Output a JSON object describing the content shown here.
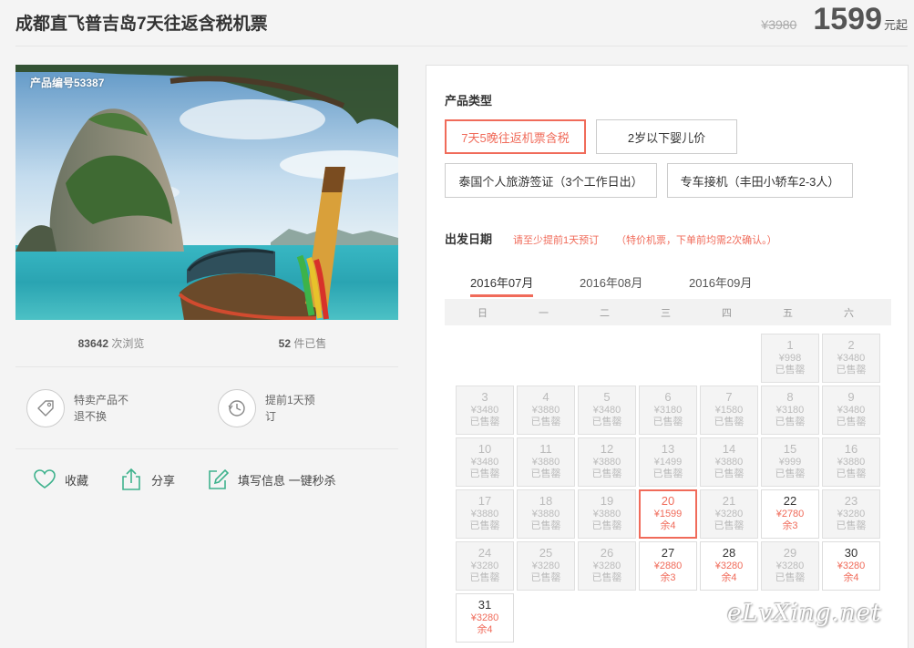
{
  "header": {
    "title": "成都直飞普吉岛7天往返含税机票",
    "old_price": "¥3980",
    "price": "1599",
    "price_suffix": "元起"
  },
  "product": {
    "code_label": "产品编号53387",
    "views_count": "83642",
    "views_label": "次浏览",
    "sold_count": "52",
    "sold_label": "件已售"
  },
  "features": [
    {
      "icon": "tag-icon",
      "text": "特卖产品不退不换"
    },
    {
      "icon": "clock-icon",
      "text": "提前1天预订"
    }
  ],
  "actions": {
    "favorite": "收藏",
    "share": "分享",
    "quick_buy": "填写信息 一键秒杀"
  },
  "booking": {
    "product_type_label": "产品类型",
    "product_types": [
      "7天5晚往返机票含税",
      "2岁以下婴儿价",
      "泰国个人旅游签证（3个工作日出）",
      "专车接机（丰田小轿车2-3人）"
    ],
    "departure_label": "出发日期",
    "note1": "请至少提前1天预订",
    "note2": "（特价机票，下单前均需2次确认。）",
    "months": [
      "2016年07月",
      "2016年08月",
      "2016年09月"
    ],
    "weekdays": [
      "日",
      "一",
      "二",
      "三",
      "四",
      "五",
      "六"
    ],
    "calendar": [
      {
        "day": "1",
        "price": "¥998",
        "status": "已售罄"
      },
      {
        "day": "2",
        "price": "¥3480",
        "status": "已售罄"
      },
      {
        "day": "3",
        "price": "¥3480",
        "status": "已售罄"
      },
      {
        "day": "4",
        "price": "¥3880",
        "status": "已售罄"
      },
      {
        "day": "5",
        "price": "¥3480",
        "status": "已售罄"
      },
      {
        "day": "6",
        "price": "¥3180",
        "status": "已售罄"
      },
      {
        "day": "7",
        "price": "¥1580",
        "status": "已售罄"
      },
      {
        "day": "8",
        "price": "¥3180",
        "status": "已售罄"
      },
      {
        "day": "9",
        "price": "¥3480",
        "status": "已售罄"
      },
      {
        "day": "10",
        "price": "¥3480",
        "status": "已售罄"
      },
      {
        "day": "11",
        "price": "¥3880",
        "status": "已售罄"
      },
      {
        "day": "12",
        "price": "¥3880",
        "status": "已售罄"
      },
      {
        "day": "13",
        "price": "¥1499",
        "status": "已售罄"
      },
      {
        "day": "14",
        "price": "¥3880",
        "status": "已售罄"
      },
      {
        "day": "15",
        "price": "¥999",
        "status": "已售罄"
      },
      {
        "day": "16",
        "price": "¥3880",
        "status": "已售罄"
      },
      {
        "day": "17",
        "price": "¥3880",
        "status": "已售罄"
      },
      {
        "day": "18",
        "price": "¥3880",
        "status": "已售罄"
      },
      {
        "day": "19",
        "price": "¥3880",
        "status": "已售罄"
      },
      {
        "day": "20",
        "price": "¥1599",
        "status": "余4",
        "available": true,
        "selected": true
      },
      {
        "day": "21",
        "price": "¥3280",
        "status": "已售罄"
      },
      {
        "day": "22",
        "price": "¥2780",
        "status": "余3",
        "available": true
      },
      {
        "day": "23",
        "price": "¥3280",
        "status": "已售罄"
      },
      {
        "day": "24",
        "price": "¥3280",
        "status": "已售罄"
      },
      {
        "day": "25",
        "price": "¥3280",
        "status": "已售罄"
      },
      {
        "day": "26",
        "price": "¥3280",
        "status": "已售罄"
      },
      {
        "day": "27",
        "price": "¥2880",
        "status": "余3",
        "available": true
      },
      {
        "day": "28",
        "price": "¥3280",
        "status": "余4",
        "available": true
      },
      {
        "day": "29",
        "price": "¥3280",
        "status": "已售罄"
      },
      {
        "day": "30",
        "price": "¥3280",
        "status": "余4",
        "available": true
      },
      {
        "day": "31",
        "price": "¥3280",
        "status": "余4",
        "available": true
      }
    ],
    "first_weekday": 5
  },
  "watermark": "eLvXing.net",
  "colors": {
    "accent": "#f06b5a",
    "action_icon": "#3fb28d"
  }
}
